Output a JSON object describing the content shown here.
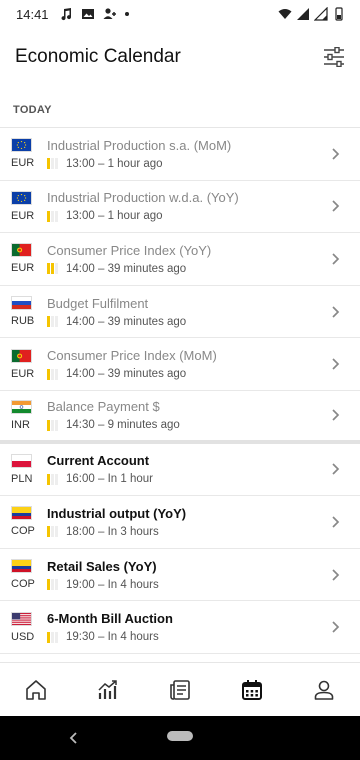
{
  "status_bar": {
    "time": "14:41"
  },
  "header": {
    "title": "Economic Calendar"
  },
  "section": {
    "label": "TODAY"
  },
  "events": [
    {
      "flag": "eu",
      "currency": "EUR",
      "name": "Industrial Production s.a. (MoM)",
      "time": "13:00 – 1 hour ago",
      "impact": 1,
      "past": true
    },
    {
      "flag": "eu",
      "currency": "EUR",
      "name": "Industrial Production w.d.a. (YoY)",
      "time": "13:00 – 1 hour ago",
      "impact": 1,
      "past": true
    },
    {
      "flag": "pt",
      "currency": "EUR",
      "name": "Consumer Price Index (YoY)",
      "time": "14:00 – 39 minutes ago",
      "impact": 2,
      "past": true
    },
    {
      "flag": "ru",
      "currency": "RUB",
      "name": "Budget Fulfilment",
      "time": "14:00 – 39 minutes ago",
      "impact": 1,
      "past": true
    },
    {
      "flag": "pt",
      "currency": "EUR",
      "name": "Consumer Price Index (MoM)",
      "time": "14:00 – 39 minutes ago",
      "impact": 1,
      "past": true
    },
    {
      "flag": "in",
      "currency": "INR",
      "name": "Balance Payment $",
      "time": "14:30 – 9 minutes ago",
      "impact": 1,
      "past": true
    },
    {
      "flag": "pl",
      "currency": "PLN",
      "name": "Current Account",
      "time": "16:00 – In 1 hour",
      "impact": 1,
      "past": false
    },
    {
      "flag": "co",
      "currency": "COP",
      "name": "Industrial output (YoY)",
      "time": "18:00 – In 3 hours",
      "impact": 1,
      "past": false
    },
    {
      "flag": "co",
      "currency": "COP",
      "name": "Retail Sales (YoY)",
      "time": "19:00 – In 4 hours",
      "impact": 1,
      "past": false
    },
    {
      "flag": "us",
      "currency": "USD",
      "name": "6-Month Bill Auction",
      "time": "19:30 – In 4 hours",
      "impact": 1,
      "past": false
    }
  ],
  "bottom_nav": [
    "home-icon",
    "chart-icon",
    "news-icon",
    "calendar-icon",
    "profile-icon"
  ],
  "colors": {
    "impact_on": "#f5c400",
    "impact_off": "#eeeeee",
    "accent": "#111111"
  }
}
